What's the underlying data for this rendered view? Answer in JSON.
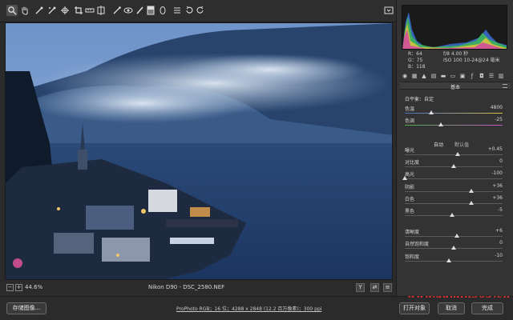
{
  "toolbar": {
    "tools": [
      "zoom-icon",
      "hand-icon",
      "eyedropper-icon",
      "color-sampler-icon",
      "targeted-adjust-icon",
      "crop-icon",
      "straighten-icon",
      "transform-icon",
      "spot-removal-icon",
      "red-eye-icon",
      "brush-icon",
      "graduated-filter-icon",
      "radial-filter-icon",
      "list-icon",
      "rotate-left-icon",
      "rotate-right-icon"
    ],
    "fullscreen_icon": "fullscreen-icon"
  },
  "status": {
    "zoom": "44.6%",
    "filename": "Nikon D90  -  DSC_2580.NEF",
    "zoom_minus": "−",
    "zoom_plus": "+",
    "view_y": "Y"
  },
  "bottom": {
    "save_label": "存储图像...",
    "workflow": "ProPhoto RGB；16 位；4288 x 2848 (12.2 百万像素)；300 ppi",
    "open_label": "打开对象",
    "cancel_label": "取消",
    "done_label": "完成",
    "watermark": "www.admin365.cn"
  },
  "readout": {
    "r": "R：64",
    "g": "G：75",
    "b": "B：118",
    "aperture": "f/8    4.00 秒",
    "iso": "ISO 100    10-24@24 毫米"
  },
  "panel": {
    "title": "基本",
    "wb_label": "白平衡：",
    "wb_value": "自定",
    "auto": "自动",
    "default": "默认值",
    "sliders": [
      {
        "label": "色温",
        "value": "4800",
        "pos": 0.27
      },
      {
        "label": "色调",
        "value": "-25",
        "pos": 0.37
      },
      {
        "label": "曝光",
        "value": "+0.45",
        "pos": 0.54
      },
      {
        "label": "对比度",
        "value": "0",
        "pos": 0.5
      },
      {
        "label": "高光",
        "value": "-100",
        "pos": 0.0
      },
      {
        "label": "阴影",
        "value": "+36",
        "pos": 0.68
      },
      {
        "label": "白色",
        "value": "+36",
        "pos": 0.68
      },
      {
        "label": "黑色",
        "value": "-5",
        "pos": 0.48
      },
      {
        "label": "清晰度",
        "value": "+6",
        "pos": 0.53
      },
      {
        "label": "自然饱和度",
        "value": "0",
        "pos": 0.5
      },
      {
        "label": "饱和度",
        "value": "-10",
        "pos": 0.45
      }
    ]
  },
  "colors": {
    "accent": "#5a8fd8",
    "watermark": "#e03232"
  }
}
